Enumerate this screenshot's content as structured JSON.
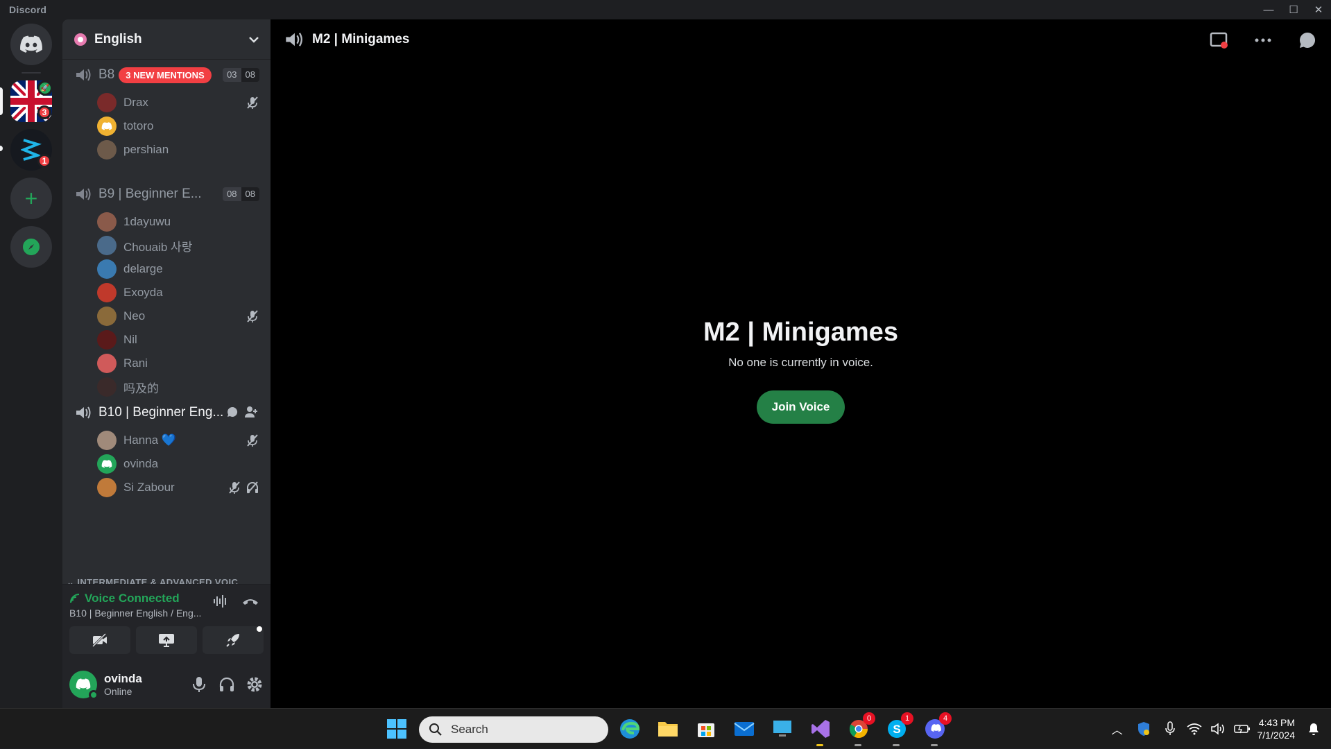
{
  "window": {
    "app_name": "Discord"
  },
  "guilds": {
    "uk_badge": "3",
    "s_badge": "1"
  },
  "server": {
    "name": "English"
  },
  "channels": [
    {
      "name": "B8",
      "mention": "3 NEW MENTIONS",
      "count_a": "03",
      "count_b": "08",
      "members": [
        {
          "name": "Drax",
          "muted": true,
          "color": "#7a2a2a"
        },
        {
          "name": "totoro",
          "muted": false,
          "color": "#f0b232"
        },
        {
          "name": "pershian",
          "muted": false,
          "color": "#6d5a4a"
        }
      ]
    },
    {
      "name": "B9 | Beginner E...",
      "count_a": "08",
      "count_b": "08",
      "members": [
        {
          "name": "1dayuwu",
          "muted": false,
          "color": "#8a5a4a"
        },
        {
          "name": "Chouaib 사랑",
          "muted": false,
          "color": "#4a6a8a"
        },
        {
          "name": "delarge",
          "muted": false,
          "color": "#3a7ab0"
        },
        {
          "name": "Exoyda",
          "muted": false,
          "color": "#c0392b"
        },
        {
          "name": "Neo",
          "muted": true,
          "color": "#8a6a3a"
        },
        {
          "name": "Nil",
          "muted": false,
          "color": "#5a1a1a"
        },
        {
          "name": "Rani",
          "muted": false,
          "color": "#d05a5a"
        },
        {
          "name": "吗及的",
          "muted": false,
          "color": "#3a2a2a"
        }
      ]
    },
    {
      "name": "B10 | Beginner Eng...",
      "members": [
        {
          "name": "Hanna 💙",
          "muted": true,
          "color": "#a08a7a"
        },
        {
          "name": "ovinda",
          "muted": false,
          "color": "#23a559"
        },
        {
          "name": "Si Zabour",
          "muted": true,
          "deafened": true,
          "color": "#c07a3a"
        }
      ]
    }
  ],
  "category": "INTERMEDIATE & ADVANCED VOIC",
  "voice": {
    "status": "Voice Connected",
    "channel": "B10 | Beginner English / Eng..."
  },
  "user": {
    "name": "ovinda",
    "status": "Online"
  },
  "main": {
    "header_title": "M2 | Minigames",
    "center_title": "M2 | Minigames",
    "center_sub": "No one is currently in voice.",
    "join_label": "Join Voice"
  },
  "taskbar": {
    "search_placeholder": "Search",
    "chrome_badge": "0",
    "skype_badge": "1",
    "discord_badge": "4",
    "time": "4:43 PM",
    "date": "7/1/2024"
  },
  "colors": {
    "accent_green": "#23a559",
    "mention_red": "#f23f43",
    "join_green": "#248046"
  }
}
